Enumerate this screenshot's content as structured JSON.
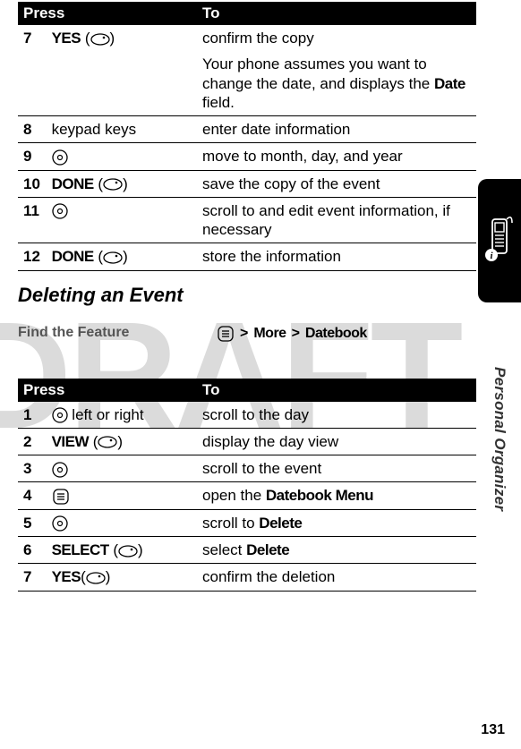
{
  "watermark": "DRAFT",
  "side_label": "Personal Organizer",
  "page_number": "131",
  "table1": {
    "head_press": "Press",
    "head_to": "To",
    "rows": [
      {
        "num": "7",
        "press_label": "YES",
        "press_suffix": " (",
        "press_end": ")",
        "key": "oval",
        "to": "confirm the copy"
      },
      {
        "num": "",
        "press_label": "",
        "key": "",
        "to_rich": {
          "pre": "Your phone assumes you want to change the date, and displays the ",
          "bold": "Date",
          "post": " field."
        }
      },
      {
        "num": "8",
        "press_plain": "keypad keys",
        "to": "enter date information"
      },
      {
        "num": "9",
        "key": "nav",
        "to": "move to month, day, and year"
      },
      {
        "num": "10",
        "press_label": "DONE",
        "press_suffix": " (",
        "press_end": ")",
        "key": "oval",
        "to": "save the copy of the event"
      },
      {
        "num": "11",
        "key": "nav",
        "to": "scroll to and edit event information, if necessary"
      },
      {
        "num": "12",
        "press_label": "DONE",
        "press_suffix": " (",
        "press_end": ")",
        "key": "oval",
        "to": "store the information"
      }
    ]
  },
  "section_heading": "Deleting an Event",
  "feature": {
    "label": "Find the Feature",
    "path": [
      ">",
      "More",
      ">",
      "Datebook"
    ]
  },
  "table2": {
    "head_press": "Press",
    "head_to": "To",
    "rows": [
      {
        "num": "1",
        "key": "nav",
        "press_suffix_text": " left or right",
        "to": "scroll to the day"
      },
      {
        "num": "2",
        "press_label": "VIEW",
        "press_suffix": " (",
        "press_end": ")",
        "key": "oval",
        "to": "display the day view"
      },
      {
        "num": "3",
        "key": "nav",
        "to": "scroll to the event"
      },
      {
        "num": "4",
        "key": "menu",
        "to_rich": {
          "pre": "open the ",
          "bold": "Datebook Menu",
          "post": ""
        }
      },
      {
        "num": "5",
        "key": "nav",
        "to_rich": {
          "pre": "scroll to ",
          "bold": "Delete",
          "post": ""
        }
      },
      {
        "num": "6",
        "press_label": "SELECT",
        "press_suffix": " (",
        "press_end": ")",
        "key": "oval",
        "to_rich": {
          "pre": "select ",
          "bold": "Delete",
          "post": ""
        }
      },
      {
        "num": "7",
        "press_label": "YES",
        "press_suffix": "(",
        "press_end": ")",
        "key": "oval",
        "to": "confirm the deletion"
      }
    ]
  }
}
